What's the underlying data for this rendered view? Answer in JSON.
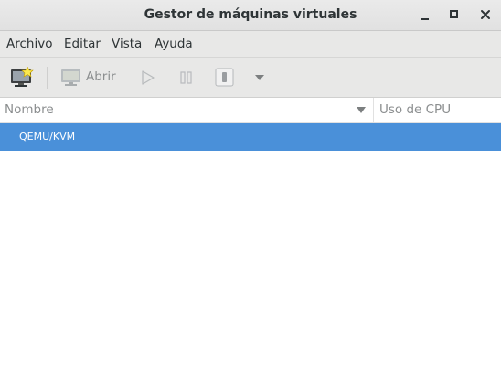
{
  "window": {
    "title": "Gestor de máquinas virtuales",
    "controls": [
      "minimize-icon",
      "maximize-icon",
      "close-icon"
    ]
  },
  "menubar": {
    "items": [
      {
        "label": "Archivo"
      },
      {
        "label": "Editar"
      },
      {
        "label": "Vista"
      },
      {
        "label": "Ayuda"
      }
    ]
  },
  "toolbar": {
    "new_vm_icon": "new-vm-icon",
    "open_label": "Abrir",
    "open_icon": "monitor-icon",
    "run_icon": "play-icon",
    "pause_icon": "pause-icon",
    "shutdown_icon": "shutdown-icon",
    "shutdown_menu_icon": "chevron-down-icon",
    "open_enabled": false,
    "run_enabled": false,
    "pause_enabled": false,
    "shutdown_enabled": false
  },
  "list": {
    "columns": [
      {
        "label": "Nombre",
        "sort": "descending"
      },
      {
        "label": "Uso de CPU"
      }
    ],
    "rows": [
      {
        "name": "QEMU/KVM",
        "selected": true
      }
    ]
  },
  "colors": {
    "selection": "#4a90d9",
    "chrome": "#e8e8e7",
    "text": "#2e3436",
    "disabled_text": "#8b8e8f"
  }
}
